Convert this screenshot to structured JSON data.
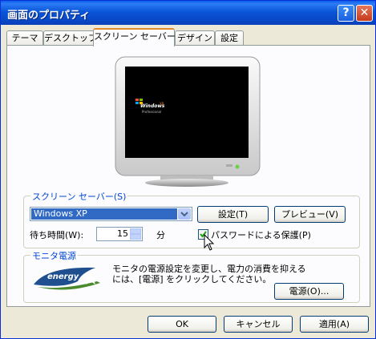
{
  "window": {
    "title": "画面のプロパティ",
    "help_glyph": "?",
    "close_glyph": "✕"
  },
  "tabs": [
    {
      "label": "テーマ"
    },
    {
      "label": "デスクトップ"
    },
    {
      "label": "スクリーン セーバー"
    },
    {
      "label": "デザイン"
    },
    {
      "label": "設定"
    }
  ],
  "preview": {
    "logo_main": "Windows",
    "logo_sup": "XP",
    "logo_sub": "Professional"
  },
  "screensaver": {
    "group_label": "スクリーン セーバー(S)",
    "selected": "Windows XP",
    "settings_label": "設定(T)",
    "preview_label": "プレビュー(V)",
    "wait_label": "待ち時間(W):",
    "wait_value": "15",
    "wait_unit": "分",
    "password_label": "パスワードによる保護(P)",
    "password_checked": true
  },
  "power": {
    "group_label": "モニタ電源",
    "description_line1": "モニタの電源設定を変更し、電力の消費を抑える",
    "description_line2": "には、[電源] をクリックしてください。",
    "power_button_label": "電源(O)...",
    "energy_text": "energy"
  },
  "footer": {
    "ok_label": "OK",
    "cancel_label": "キャンセル",
    "apply_label": "適用(A)"
  }
}
